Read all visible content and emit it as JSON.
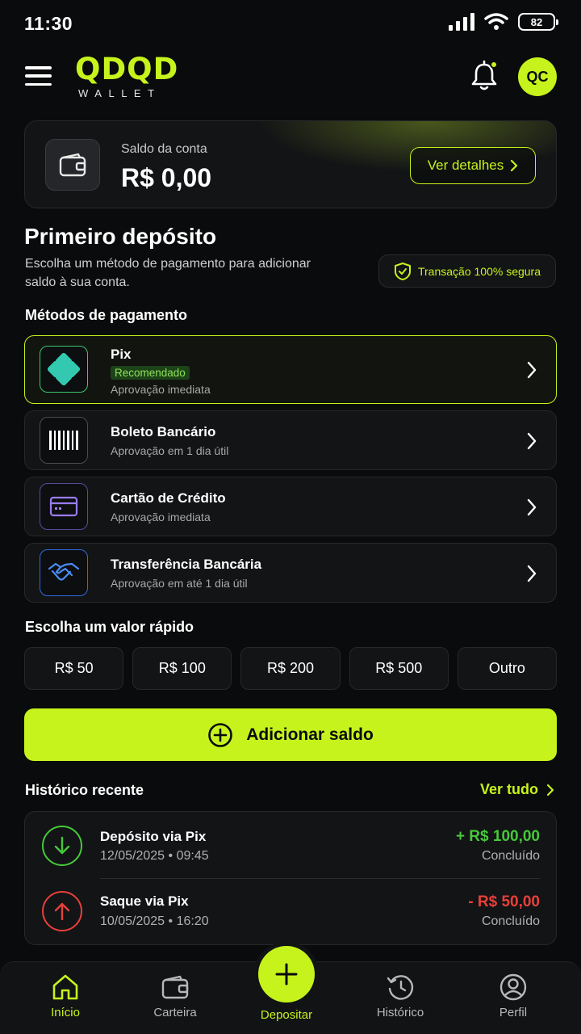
{
  "status_bar": {
    "time": "11:30",
    "battery": "82"
  },
  "header": {
    "logo_main": "QDQD",
    "logo_sub": "WALLET",
    "avatar_initials": "QC"
  },
  "balance": {
    "label": "Saldo da conta",
    "value": "R$ 0,00",
    "details_button": "Ver detalhes"
  },
  "deposit": {
    "title": "Primeiro depósito",
    "description": "Escolha um método de pagamento para adicionar saldo à sua conta.",
    "secure_badge": "Transação 100% segura"
  },
  "methods": {
    "label": "Métodos de pagamento",
    "items": [
      {
        "name": "Pix",
        "tag": "Recomendado",
        "subtitle": "Aprovação imediata",
        "icon": "pix-icon"
      },
      {
        "name": "Boleto Bancário",
        "subtitle": "Aprovação em 1 dia útil",
        "icon": "barcode-icon"
      },
      {
        "name": "Cartão de Crédito",
        "subtitle": "Aprovação imediata",
        "icon": "credit-card-icon"
      },
      {
        "name": "Transferência Bancária",
        "subtitle": "Aprovação em até 1 dia útil",
        "icon": "handshake-icon"
      }
    ]
  },
  "quick_values": {
    "label": "Escolha um valor rápido",
    "options": [
      "R$ 50",
      "R$ 100",
      "R$ 200",
      "R$ 500",
      "Outro"
    ]
  },
  "add_button": "Adicionar saldo",
  "history": {
    "label": "Histórico recente",
    "see_all": "Ver tudo",
    "items": [
      {
        "name": "Depósito via Pix",
        "date": "12/05/2025 • 09:45",
        "amount": "+ R$ 100,00",
        "status": "Concluído",
        "type": "in"
      },
      {
        "name": "Saque via Pix",
        "date": "10/05/2025 • 16:20",
        "amount": "- R$ 50,00",
        "status": "Concluído",
        "type": "out"
      }
    ]
  },
  "nav": {
    "items": [
      {
        "label": "Início",
        "icon": "home-icon"
      },
      {
        "label": "Carteira",
        "icon": "wallet-icon"
      },
      {
        "label": "Depositar",
        "icon": "plus-icon"
      },
      {
        "label": "Histórico",
        "icon": "history-icon"
      },
      {
        "label": "Perfil",
        "icon": "profile-icon"
      }
    ]
  },
  "colors": {
    "accent": "#c6f31c",
    "background": "#0a0b0c",
    "card": "#131416",
    "positive": "#46c93a",
    "negative": "#e8403a"
  }
}
